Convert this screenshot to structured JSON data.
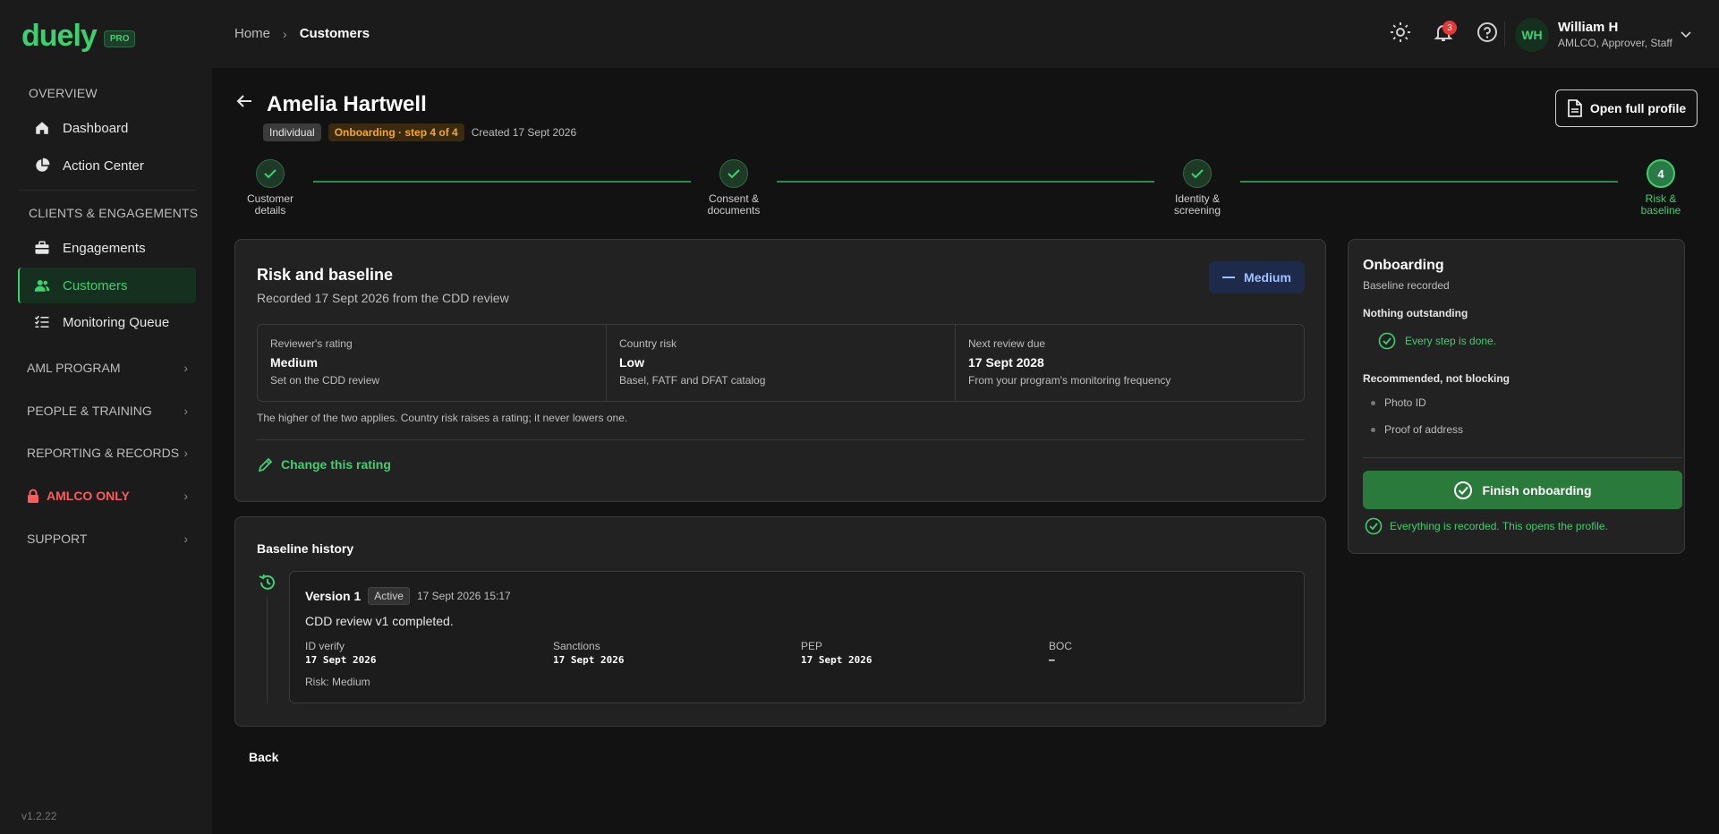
{
  "brand": {
    "name": "duely",
    "badge": "PRO"
  },
  "sidebar": {
    "sections": {
      "overview": "OVERVIEW",
      "clients": "CLIENTS & ENGAGEMENTS"
    },
    "items": {
      "dashboard": "Dashboard",
      "action_center": "Action Center",
      "engagements": "Engagements",
      "customers": "Customers",
      "monitoring_queue": "Monitoring Queue"
    },
    "groups": {
      "aml_program": "AML PROGRAM",
      "people_training": "PEOPLE & TRAINING",
      "reporting_records": "REPORTING & RECORDS",
      "amlco_only": "AMLCO ONLY",
      "support": "SUPPORT"
    },
    "version": "v1.2.22"
  },
  "topbar": {
    "breadcrumb": {
      "home": "Home",
      "current": "Customers"
    },
    "notification_count": "3",
    "user": {
      "initials": "WH",
      "name": "William H",
      "roles": "AMLCO, Approver, Staff"
    }
  },
  "customer": {
    "name": "Amelia Hartwell",
    "type_tag": "Individual",
    "onboarding_tag": "Onboarding · step 4 of 4",
    "created": "Created 17 Sept 2026",
    "open_profile_label": "Open full profile"
  },
  "stepper": {
    "steps": [
      {
        "line1": "Customer",
        "line2": "details"
      },
      {
        "line1": "Consent &",
        "line2": "documents"
      },
      {
        "line1": "Identity &",
        "line2": "screening"
      },
      {
        "line1": "Risk &",
        "line2": "baseline",
        "number": "4"
      }
    ]
  },
  "risk": {
    "title": "Risk and baseline",
    "subtitle": "Recorded 17 Sept 2026 from the CDD review",
    "badge": "Medium",
    "metrics": [
      {
        "label": "Reviewer's rating",
        "value": "Medium",
        "sub": "Set on the CDD review"
      },
      {
        "label": "Country risk",
        "value": "Low",
        "sub": "Basel, FATF and DFAT catalog"
      },
      {
        "label": "Next review due",
        "value": "17 Sept 2028",
        "sub": "From your program's monitoring frequency"
      }
    ],
    "note": "The higher of the two applies. Country risk raises a rating; it never lowers one.",
    "change_label": "Change this rating"
  },
  "history": {
    "title": "Baseline history",
    "version": {
      "name": "Version 1",
      "status": "Active",
      "timestamp": "17 Sept 2026 15:17",
      "description": "CDD review v1 completed.",
      "checks": [
        {
          "label": "ID verify",
          "value": "17 Sept 2026"
        },
        {
          "label": "Sanctions",
          "value": "17 Sept 2026"
        },
        {
          "label": "PEP",
          "value": "17 Sept 2026"
        },
        {
          "label": "BOC",
          "value": "–"
        }
      ],
      "risk": "Risk: Medium"
    }
  },
  "back_label": "Back",
  "onboarding": {
    "title": "Onboarding",
    "subtitle": "Baseline recorded",
    "outstanding_heading": "Nothing outstanding",
    "done_text": "Every step is done.",
    "recommended_heading": "Recommended, not blocking",
    "recommended": [
      "Photo ID",
      "Proof of address"
    ],
    "finish_label": "Finish onboarding",
    "footer": "Everything is recorded. This opens the profile."
  },
  "colors": {
    "accent": "#3ecf6e",
    "warning": "#f5a623",
    "danger": "#ff5a5a",
    "info": "#9fc1ff"
  }
}
